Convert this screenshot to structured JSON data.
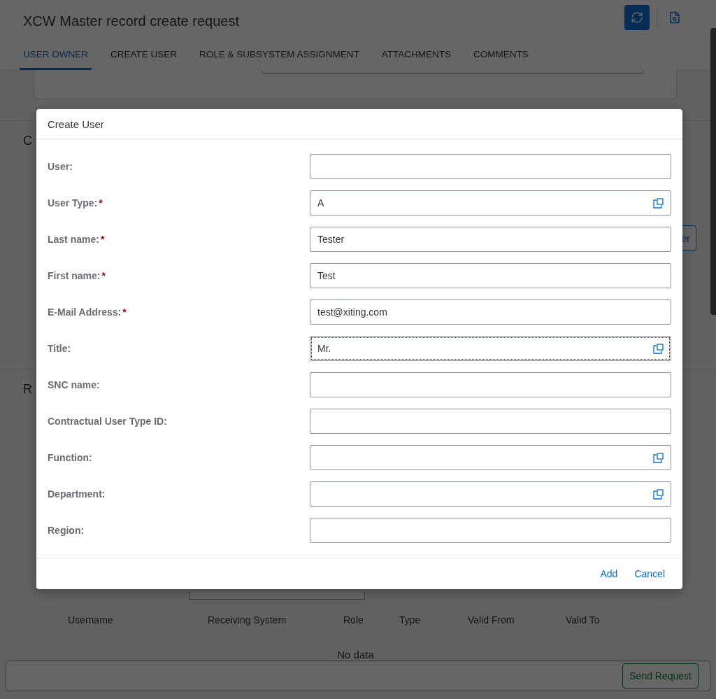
{
  "page": {
    "title": "XCW Master record create request",
    "tabs": [
      {
        "label": "USER OWNER",
        "selected": true
      },
      {
        "label": "CREATE USER",
        "selected": false
      },
      {
        "label": "ROLE & SUBSYSTEM ASSIGNMENT",
        "selected": false
      },
      {
        "label": "ATTACHMENTS",
        "selected": false
      },
      {
        "label": "COMMENTS",
        "selected": false
      }
    ],
    "sections": [
      {
        "title": "C"
      },
      {
        "title": "R"
      }
    ],
    "side_button": "er",
    "table": {
      "columns": [
        "Username",
        "Receiving System",
        "Role",
        "Type",
        "Valid From",
        "Valid To"
      ],
      "empty_text": "No data"
    },
    "footer": {
      "button": "Send Request"
    }
  },
  "dialog": {
    "title": "Create User",
    "fields": [
      {
        "label": "User:",
        "kind": "text",
        "focused": false
      },
      {
        "label": "User Type:",
        "required_mark": "*",
        "kind": "value_help",
        "value": "A",
        "focused": false
      },
      {
        "label": "Last name:",
        "required_mark": "*",
        "kind": "text",
        "value": "Tester",
        "focused": false
      },
      {
        "label": "First name:",
        "required_mark": "*",
        "kind": "text",
        "value": "Test",
        "focused": false
      },
      {
        "label": "E-Mail Address:",
        "required_mark": "*",
        "kind": "text",
        "value": "test@xiting.com",
        "focused": false
      },
      {
        "label": "Title:",
        "kind": "value_help",
        "value": "Mr.",
        "focused": true
      },
      {
        "label": "SNC name:",
        "kind": "text",
        "focused": false
      },
      {
        "label": "Contractual User Type ID:",
        "kind": "text",
        "focused": false
      },
      {
        "label": "Function:",
        "kind": "value_help",
        "focused": false
      },
      {
        "label": "Department:",
        "kind": "value_help",
        "focused": false
      },
      {
        "label": "Region:",
        "kind": "text",
        "focused": false
      }
    ],
    "buttons": [
      "Add",
      "Cancel"
    ]
  }
}
